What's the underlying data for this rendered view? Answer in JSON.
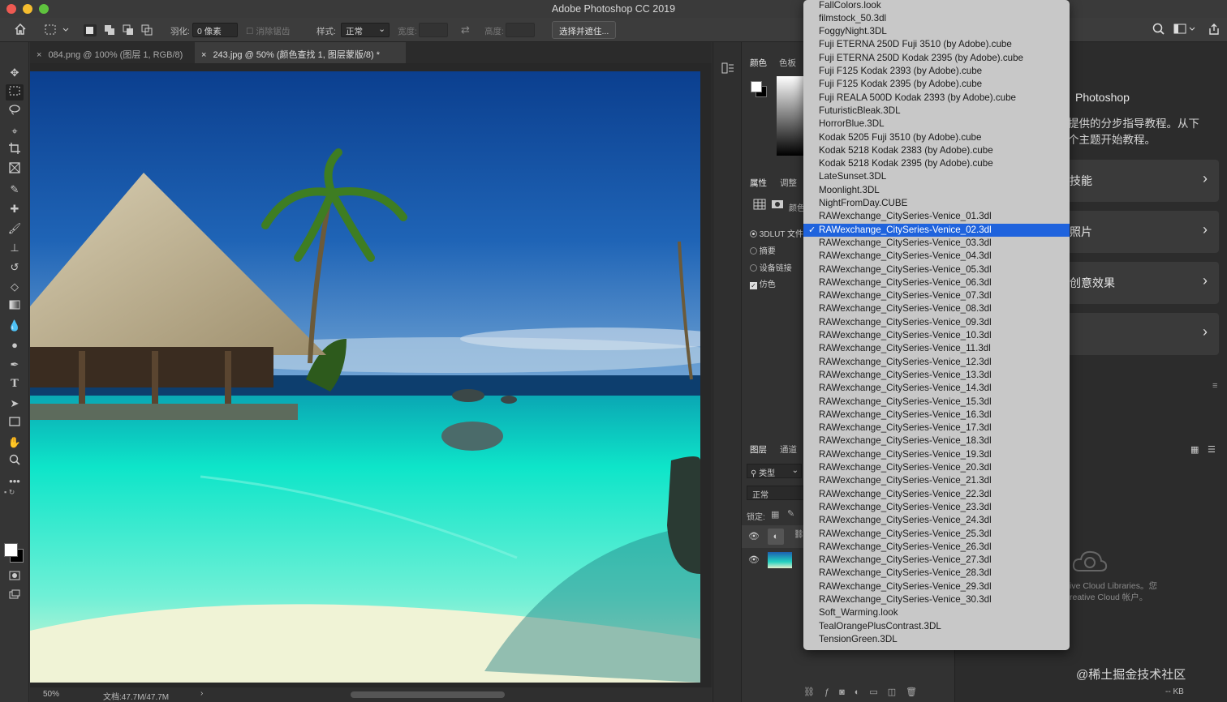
{
  "window": {
    "title": "Adobe Photoshop CC 2019"
  },
  "options_bar": {
    "feather_label": "羽化:",
    "feather_value": "0 像素",
    "antialias_label": "消除锯齿",
    "style_label": "样式:",
    "style_value": "正常",
    "width_label": "宽度:",
    "height_label": "高度:",
    "select_mask_button": "选择并遮住..."
  },
  "tabs": [
    {
      "label": "084.png @ 100% (图层 1, RGB/8)",
      "active": false
    },
    {
      "label": "243.jpg @ 50% (颜色查找 1, 图层蒙版/8) *",
      "active": true
    }
  ],
  "status": {
    "zoom": "50%",
    "doc": "文档:47.7M/47.7M"
  },
  "color_panel": {
    "tab_color": "颜色",
    "tab_swatches": "色板"
  },
  "properties_panel": {
    "tab_properties": "属性",
    "tab_adjustments": "调整",
    "color_label": "颜色",
    "option_3dlut": "3DLUT 文件",
    "option_abstract": "摘要",
    "option_devicelink": "设备链接",
    "option_dither": "仿色"
  },
  "layers_panel": {
    "tab_layers": "图层",
    "tab_channels": "通道",
    "filter_label": "类型",
    "blend_mode": "正常",
    "lock_label": "锁定:"
  },
  "learn_panel": {
    "title": "Photoshop",
    "desc_line1": "提供的分步指导教程。从下",
    "desc_line2": "个主题开始教程。",
    "cards": [
      "技能",
      "照片",
      "创意效果",
      ""
    ]
  },
  "libraries": {
    "line1": "ive Cloud Libraries。您",
    "line2": "reative Cloud 帐户。",
    "kb": "-- KB"
  },
  "watermark_footer": "@稀土掘金技术社区",
  "lut_dropdown": {
    "selected_index": 17,
    "items": [
      "FallColors.look",
      "filmstock_50.3dl",
      "FoggyNight.3DL",
      "Fuji ETERNA 250D Fuji 3510 (by Adobe).cube",
      "Fuji ETERNA 250D Kodak 2395 (by Adobe).cube",
      "Fuji F125 Kodak 2393 (by Adobe).cube",
      "Fuji F125 Kodak 2395 (by Adobe).cube",
      "Fuji REALA 500D Kodak 2393 (by Adobe).cube",
      "FuturisticBleak.3DL",
      "HorrorBlue.3DL",
      "Kodak 5205 Fuji 3510 (by Adobe).cube",
      "Kodak 5218 Kodak 2383 (by Adobe).cube",
      "Kodak 5218 Kodak 2395 (by Adobe).cube",
      "LateSunset.3DL",
      "Moonlight.3DL",
      "NightFromDay.CUBE",
      "RAWexchange_CitySeries-Venice_01.3dl",
      "RAWexchange_CitySeries-Venice_02.3dl",
      "RAWexchange_CitySeries-Venice_03.3dl",
      "RAWexchange_CitySeries-Venice_04.3dl",
      "RAWexchange_CitySeries-Venice_05.3dl",
      "RAWexchange_CitySeries-Venice_06.3dl",
      "RAWexchange_CitySeries-Venice_07.3dl",
      "RAWexchange_CitySeries-Venice_08.3dl",
      "RAWexchange_CitySeries-Venice_09.3dl",
      "RAWexchange_CitySeries-Venice_10.3dl",
      "RAWexchange_CitySeries-Venice_11.3dl",
      "RAWexchange_CitySeries-Venice_12.3dl",
      "RAWexchange_CitySeries-Venice_13.3dl",
      "RAWexchange_CitySeries-Venice_14.3dl",
      "RAWexchange_CitySeries-Venice_15.3dl",
      "RAWexchange_CitySeries-Venice_16.3dl",
      "RAWexchange_CitySeries-Venice_17.3dl",
      "RAWexchange_CitySeries-Venice_18.3dl",
      "RAWexchange_CitySeries-Venice_19.3dl",
      "RAWexchange_CitySeries-Venice_20.3dl",
      "RAWexchange_CitySeries-Venice_21.3dl",
      "RAWexchange_CitySeries-Venice_22.3dl",
      "RAWexchange_CitySeries-Venice_23.3dl",
      "RAWexchange_CitySeries-Venice_24.3dl",
      "RAWexchange_CitySeries-Venice_25.3dl",
      "RAWexchange_CitySeries-Venice_26.3dl",
      "RAWexchange_CitySeries-Venice_27.3dl",
      "RAWexchange_CitySeries-Venice_28.3dl",
      "RAWexchange_CitySeries-Venice_29.3dl",
      "RAWexchange_CitySeries-Venice_30.3dl",
      "Soft_Warming.look",
      "TealOrangePlusContrast.3DL",
      "TensionGreen.3DL"
    ]
  },
  "colors": {
    "selection": "#1f63dd",
    "dropdown_bg": "#c8c8c8",
    "panel_bg": "#323232"
  }
}
